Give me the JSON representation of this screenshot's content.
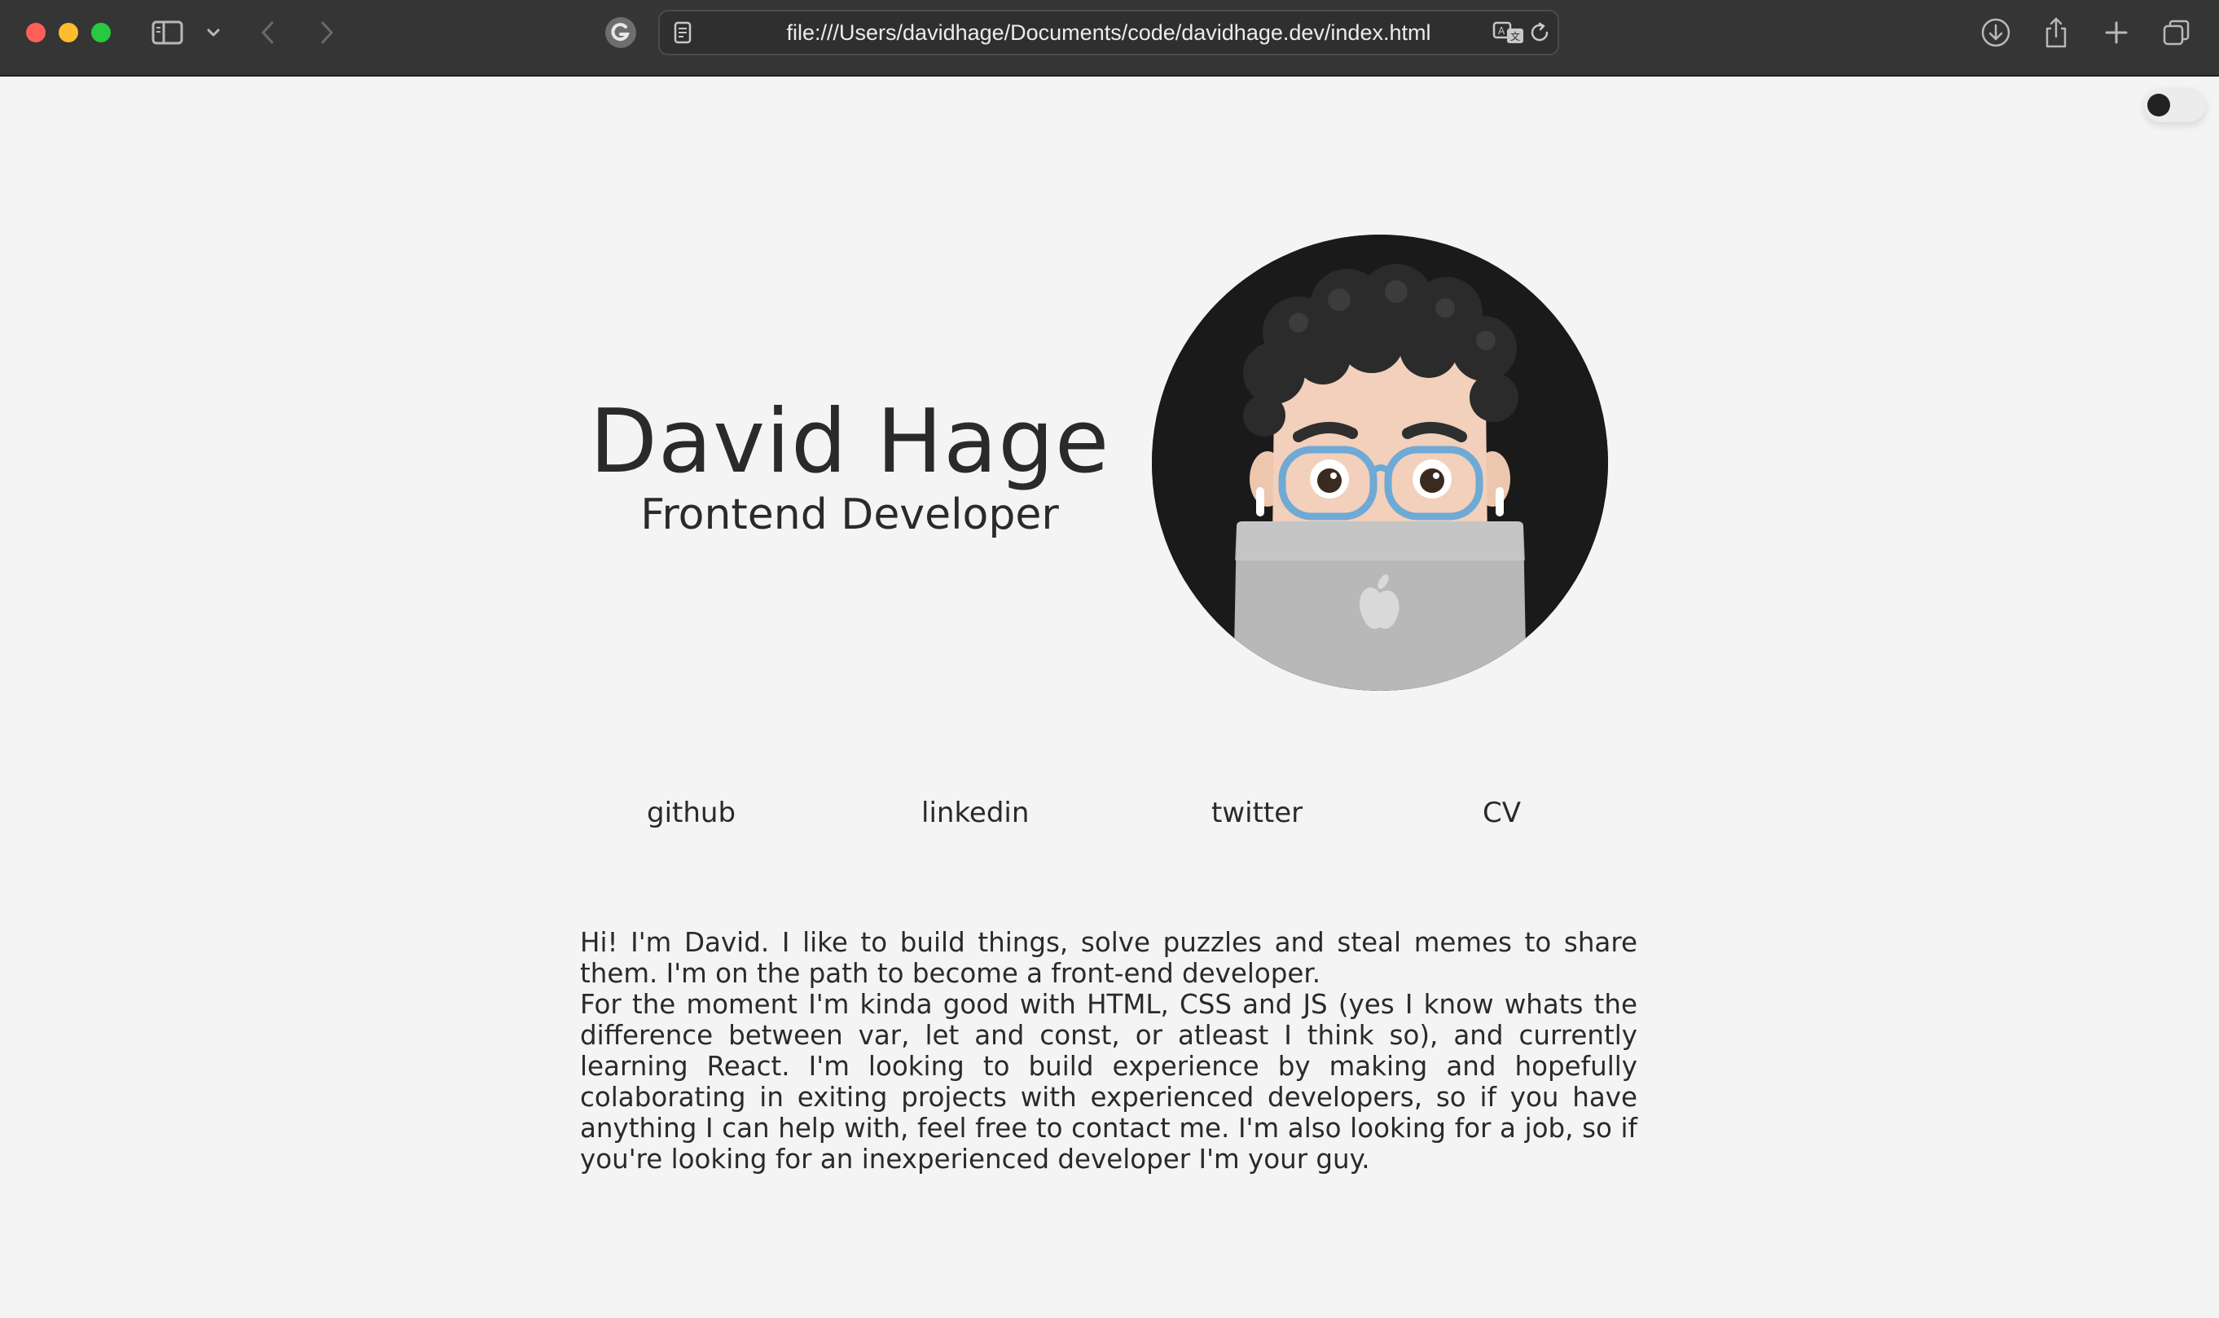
{
  "browser": {
    "url": "file:///Users/davidhage/Documents/code/davidhage.dev/index.html",
    "toolbar_icons": [
      "sidebar-icon",
      "chevron-down-icon",
      "back-icon",
      "forward-icon",
      "grammarly-icon",
      "page-icon",
      "translate-icon",
      "reload-icon",
      "download-icon",
      "share-icon",
      "plus-icon",
      "tabs-icon"
    ]
  },
  "page": {
    "theme_toggle": {
      "state": "off"
    },
    "hero": {
      "name": "David Hage",
      "role": "Frontend Developer",
      "avatar_icon": "memoji-avatar-with-laptop"
    },
    "links": [
      {
        "label": "github"
      },
      {
        "label": "linkedin"
      },
      {
        "label": "twitter"
      },
      {
        "label": "CV"
      }
    ],
    "bio": [
      "Hi! I'm David. I like to build things, solve puzzles and steal memes to share them. I'm on the path to become a front-end developer.",
      "For the moment I'm kinda good with HTML, CSS and JS (yes I know whats the difference between var, let and const, or atleast I think so), and currently learning React. I'm looking to build experience by making and hopefully colaborating in exiting projects with experienced developers, so if you have anything I can help with, feel free to contact me. I'm also looking for a job, so if you're looking for an inexperienced developer I'm your guy."
    ]
  },
  "colors": {
    "page_bg": "#f4f4f4",
    "text": "#2a2a2a",
    "chrome_bg": "#353535",
    "avatar_bg": "#1a1a1a"
  }
}
